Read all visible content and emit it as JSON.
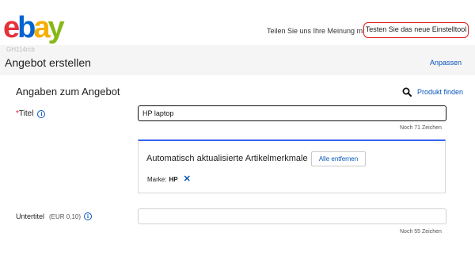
{
  "header": {
    "logo": {
      "e": "e",
      "b": "b",
      "a": "a",
      "y": "y"
    },
    "feedback_text": "Teilen Sie uns Ihre Meinung mit",
    "new_tool_label": "Testen Sie das neue Einstelltool"
  },
  "page": {
    "build_id": "GH114rcb",
    "title": "Angebot erstellen",
    "customize_label": "Anpassen"
  },
  "section": {
    "title": "Angaben zum Angebot",
    "find_product_label": "Produkt finden"
  },
  "title_field": {
    "required_marker": "*",
    "label": "Titel",
    "info_icon": "i",
    "value": "HP laptop",
    "char_count": "Noch 71  Zeichen"
  },
  "attributes": {
    "heading": "Automatisch aktualisierte Artikelmerkmale",
    "remove_all_label": "Alle entfernen",
    "brand_label": "Marke:",
    "brand_value": "HP",
    "remove_icon": "✕"
  },
  "subtitle_field": {
    "label": "Untertitel",
    "fee": "(EUR 0,10)",
    "info_icon": "i",
    "value": "",
    "char_count": "Noch 55  Zeichen"
  },
  "colors": {
    "accent_link": "#0654ba",
    "highlight_border": "#e01e1e",
    "attr_top_border": "#3665f3",
    "required": "#dd1e31"
  }
}
